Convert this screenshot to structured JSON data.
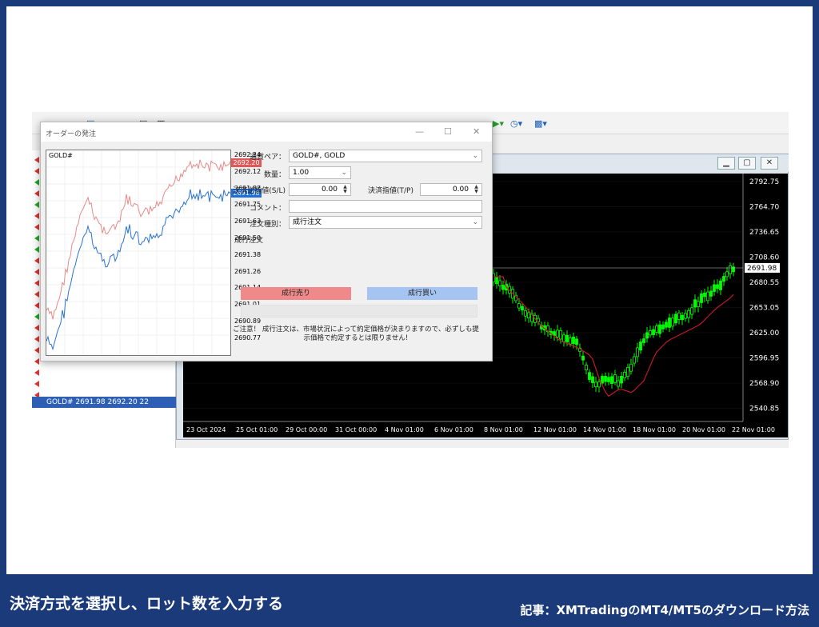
{
  "footer": {
    "caption": "決済方式を選択し、ロット数を入力する",
    "article": "記事：XMTradingのMT4/MT5のダウンロード方法"
  },
  "dialog": {
    "title": "オーダーの発注",
    "tick_chart_symbol": "GOLD#",
    "price_scale": [
      "2692.24",
      "2692.12",
      "2691.87",
      "2691.75",
      "2691.63",
      "2691.50",
      "2691.38",
      "2691.26",
      "2691.14",
      "2691.01",
      "2690.89",
      "2690.77"
    ],
    "ask_marker": "2692.20",
    "bid_marker": "2691.98",
    "symbol_label": "通貨ペア：",
    "symbol_value": "GOLD#, GOLD",
    "volume_label": "数量：",
    "volume_value": "1.00",
    "sl_label": "決済逆指値(S/L)",
    "sl_value": "0.00",
    "tp_label": "決済指値(T/P)",
    "tp_value": "0.00",
    "comment_label": "コメント：",
    "comment_value": "",
    "order_type_label": "注文種別：",
    "order_type_value": "成行注文",
    "section_title": "成行注文",
    "sell_button": "成行売り",
    "buy_button": "成行買い",
    "note": "ご注意！ 成行注文は、市場状況によって約定価格が決まりますので、必ずしも提示価格で約定するとは限りません!"
  },
  "market_watch": {
    "selected_row": "GOLD#",
    "selected_bid": "2691.98",
    "selected_ask": "2692.20",
    "selected_spread": "22"
  },
  "chart": {
    "price_ticks": [
      "2792.75",
      "2764.70",
      "2736.65",
      "2708.60",
      "2680.55",
      "2653.05",
      "2625.00",
      "2596.95",
      "2568.90",
      "2540.85"
    ],
    "current_price": "2691.98",
    "time_ticks": [
      "23 Oct 2024",
      "25 Oct 01:00",
      "29 Oct 00:00",
      "31 Oct 00:00",
      "4 Nov 01:00",
      "6 Nov 01:00",
      "8 Nov 01:00",
      "12 Nov 01:00",
      "14 Nov 01:00",
      "18 Nov 01:00",
      "20 Nov 01:00",
      "22 Nov 01:00"
    ],
    "colors": {
      "background": "#000000",
      "bull": "#00ff00",
      "ma": "#c0182a"
    }
  }
}
